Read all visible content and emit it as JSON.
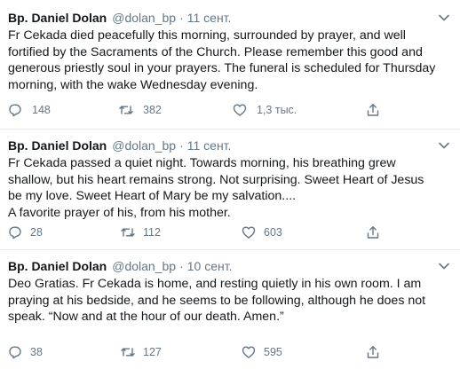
{
  "tweets": [
    {
      "name": "Bp. Daniel Dolan",
      "handle": "@dolan_bp",
      "separator": "·",
      "date": "11 сент.",
      "text": "Fr Cekada died peacefully this morning, surrounded by prayer, and well\nfortified by the Sacraments of the  Church. Please remember this good and\ngenerous priestly soul in your prayers. The funeral is scheduled for Thursday\nmorning, with the wake Wednesday evening.",
      "replies": "148",
      "retweets": "382",
      "likes": "1,3 тыс."
    },
    {
      "name": "Bp. Daniel Dolan",
      "handle": "@dolan_bp",
      "separator": "·",
      "date": "11 сент.",
      "text": "Fr Cekada passed a quiet night. Towards morning, his breathing grew\nshallow, but his heart remains strong. Not surprising. Sweet Heart of Jesus\nbe my love. Sweet Heart of Mary be my salvation....\nA favorite prayer of his, from his mother.",
      "replies": "28",
      "retweets": "112",
      "likes": "603"
    },
    {
      "name": "Bp. Daniel Dolan",
      "handle": "@dolan_bp",
      "separator": "·",
      "date": "10 сент.",
      "text": "Deo Gratias. Fr Cekada is home, and resting quietly in his own room. I am\npraying at his bedside, and he seems to be following, although he does not\nspeak. “Now and at the hour of our death. Amen.”",
      "replies": "38",
      "retweets": "127",
      "likes": "595"
    }
  ],
  "icons": {
    "reply": "reply-icon",
    "retweet": "retweet-icon",
    "like": "heart-icon",
    "share": "share-icon",
    "menu": "chevron-down-icon"
  },
  "colors": {
    "text": "#14171a",
    "muted": "#657786",
    "divider": "#e6ecf0"
  }
}
